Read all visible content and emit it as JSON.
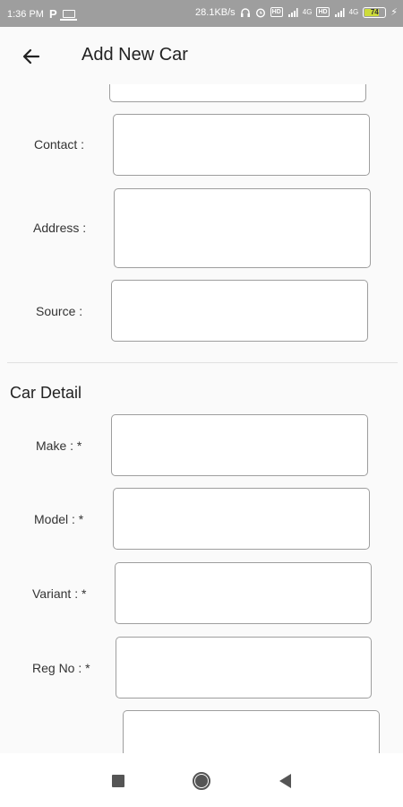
{
  "status_bar": {
    "time": "1:36 PM",
    "network_speed": "28.1KB/s",
    "sim1": "4G",
    "sim2": "4G",
    "battery_percent": "74",
    "battery_level": 0.74,
    "battery_color": "#cddc39"
  },
  "app_bar": {
    "back_icon": "arrow-left-icon",
    "title": "Add New Car"
  },
  "form": {
    "contact_label": "Contact :",
    "address_label": "Address :",
    "source_label": "Source :"
  },
  "car_detail": {
    "section_title": "Car Detail",
    "make_label": "Make : *",
    "model_label": "Model : *",
    "variant_label": "Variant : *",
    "reg_no_label": "Reg No : *"
  },
  "nav_bar": {
    "recents_icon": "square-icon",
    "home_icon": "circle-icon",
    "back_icon": "triangle-back-icon"
  }
}
